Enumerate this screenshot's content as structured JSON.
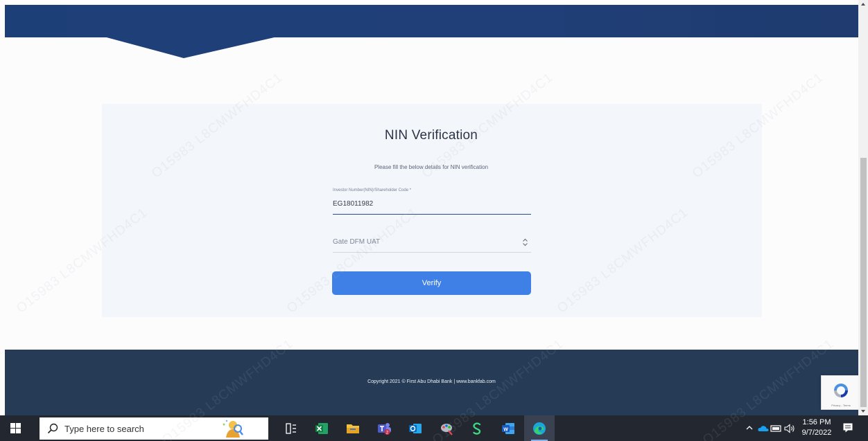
{
  "verification_card": {
    "title": "NIN Verification",
    "subtitle": "Please fill the below details for NIN verification",
    "investor_field": {
      "label": "Investor Number(NIN)/Shareholder Code *",
      "value": "EG18011982"
    },
    "exchange_select": {
      "selected": "Gate DFM UAT"
    },
    "verify_button_label": "Verify"
  },
  "footer": {
    "copyright": "Copyright 2021 © First Abu Dhabi Bank | www.bankfab.com"
  },
  "recaptcha": {
    "links": "Privacy - Terms"
  },
  "watermark": {
    "text": "O15983 L8CMWFHD4C1"
  },
  "taskbar": {
    "search_placeholder": "Type here to search",
    "clock_time": "1:56 PM",
    "clock_date": "9/7/2022",
    "icons": [
      "windows-start-icon",
      "task-view-icon",
      "excel-icon",
      "file-explorer-icon",
      "teams-icon",
      "outlook-icon",
      "snipping-tool-icon",
      "s-app-icon",
      "word-icon",
      "edge-icon"
    ]
  },
  "colors": {
    "header_blue": "#203f79",
    "footer_navy": "#253b56",
    "button_blue": "#3f80e7",
    "taskbar": "#232830"
  }
}
